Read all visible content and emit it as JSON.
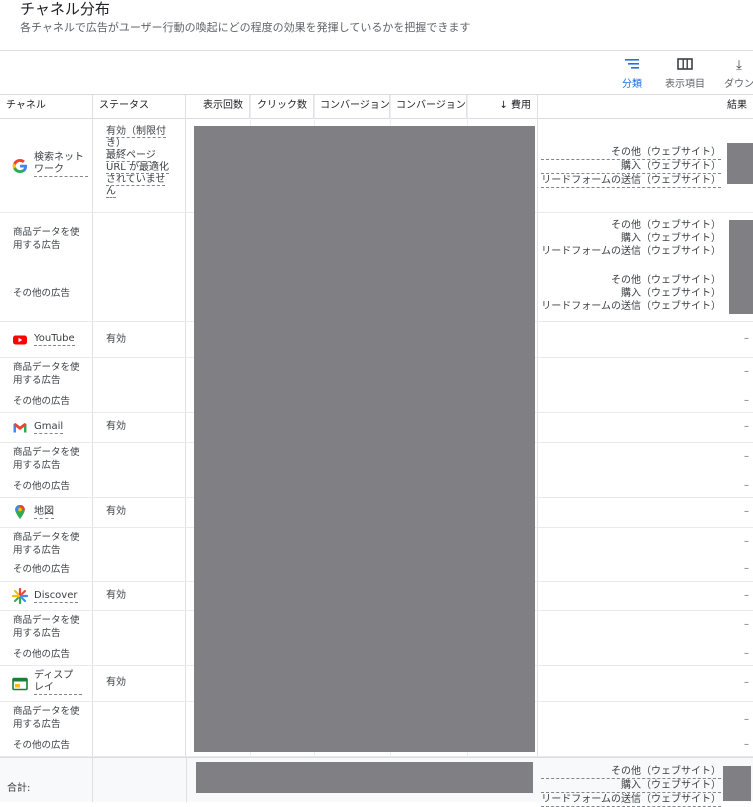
{
  "header": {
    "title": "チャネル分布",
    "subtitle": "各チャネルで広告がユーザー行動の喚起にどの程度の効果を発揮しているかを把握できます"
  },
  "toolbar": {
    "segment_label": "分類",
    "columns_label": "表示項目",
    "download_label": "ダウン"
  },
  "table": {
    "headers": {
      "channel": "チャネル",
      "status": "ステータス",
      "impressions": "表示回数",
      "clicks": "クリック数",
      "conversions": "コンバージョン",
      "conversion_value": "コンバージョン",
      "cost": "費用",
      "results": "結果"
    },
    "search": {
      "name": "検索ネットワーク",
      "status": "有効（制限付き）",
      "status_detail": "最終ページ URL が最適化されていません",
      "results": [
        "その他（ウェブサイト）",
        "購入（ウェブサイト）",
        "リードフォームの送信（ウェブサイト）"
      ]
    },
    "product_row": {
      "product": "商品データを使用する広告",
      "other": "その他の広告",
      "results_a": [
        "その他（ウェブサイト）",
        "購入（ウェブサイト）",
        "リードフォームの送信（ウェブサイト）"
      ],
      "results_b": [
        "その他（ウェブサイト）",
        "購入（ウェブサイト）",
        "リードフォームの送信（ウェブサイト）"
      ]
    },
    "channels": [
      {
        "name": "YouTube",
        "status": "有効"
      },
      {
        "name": "Gmail",
        "status": "有効"
      },
      {
        "name": "地図",
        "status": "有効"
      },
      {
        "name": "Discover",
        "status": "有効"
      },
      {
        "name": "ディスプレイ",
        "status": "有効"
      }
    ],
    "sub_product": "商品データを使用する広告",
    "sub_other": "その他の広告",
    "empty": "–",
    "total_label": "合計:",
    "total_results": [
      "その他（ウェブサイト）",
      "購入（ウェブサイト）",
      "リードフォームの送信（ウェブサイト）"
    ]
  },
  "colors": {
    "accent": "#1a73e8",
    "redaction": "#808084"
  }
}
